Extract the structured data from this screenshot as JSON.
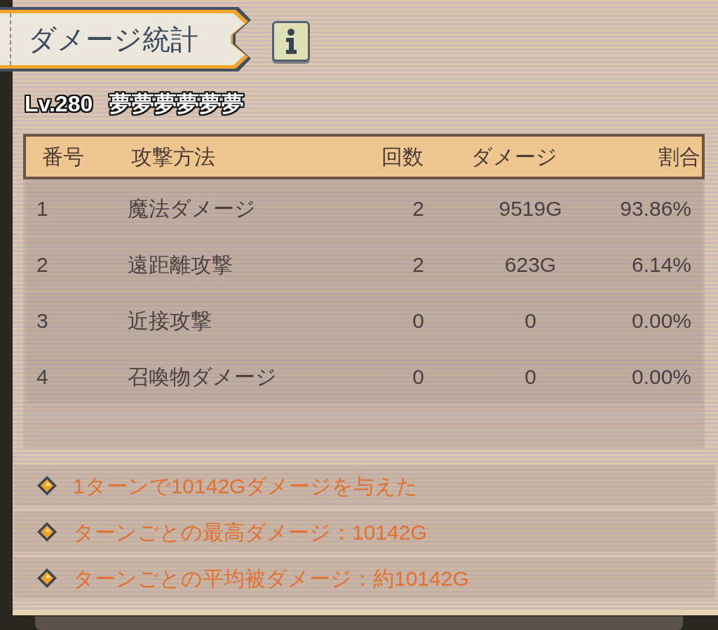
{
  "panel": {
    "title": "ダメージ統計"
  },
  "player": {
    "level": "Lv.280",
    "name": "夢夢夢夢夢夢"
  },
  "table": {
    "columns": [
      "番号",
      "攻撃方法",
      "回数",
      "ダメージ",
      "割合"
    ],
    "rows": [
      {
        "number": "1",
        "method": "魔法ダメージ",
        "count": "2",
        "damage": "9519G",
        "share": "93.86%"
      },
      {
        "number": "2",
        "method": "遠距離攻撃",
        "count": "2",
        "damage": "623G",
        "share": "6.14%"
      },
      {
        "number": "3",
        "method": "近接攻撃",
        "count": "0",
        "damage": "0",
        "share": "0.00%"
      },
      {
        "number": "4",
        "method": "召喚物ダメージ",
        "count": "0",
        "damage": "0",
        "share": "0.00%"
      }
    ]
  },
  "summary": [
    "1ターンで10142Gダメージを与えた",
    "ターンごとの最高ダメージ：10142G",
    "ターンごとの平均被ダメージ：約10142G"
  ]
}
